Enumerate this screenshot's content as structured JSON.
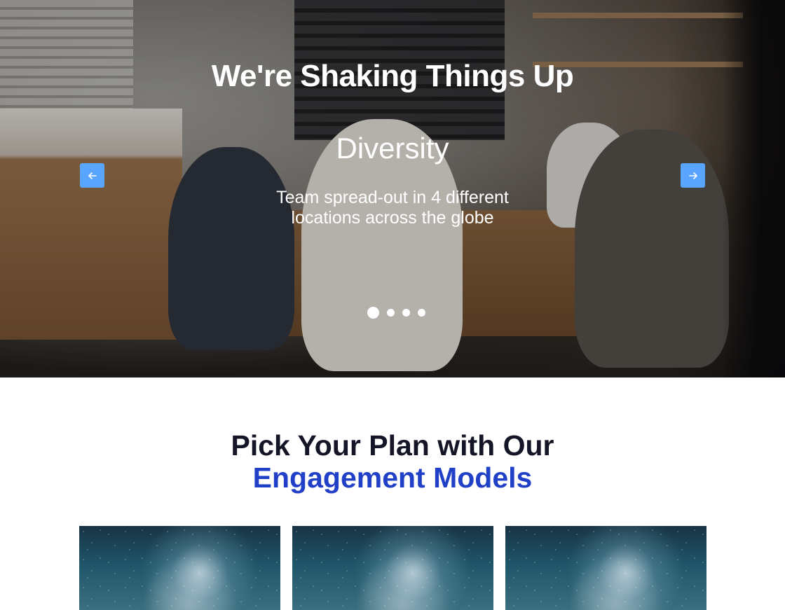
{
  "hero": {
    "title": "We're Shaking Things Up",
    "slide": {
      "heading": "Diversity",
      "text": "Team spread-out in 4 different locations across the globe"
    },
    "prev_icon": "arrow-left-icon",
    "next_icon": "arrow-right-icon",
    "slide_count": 4,
    "active_slide": 1,
    "arrow_color": "#5aa5ff"
  },
  "plans": {
    "title_line1": "Pick Your Plan with Our",
    "title_line2": "Engagement Models",
    "title_color": "#151528",
    "accent_color": "#2140c8"
  }
}
